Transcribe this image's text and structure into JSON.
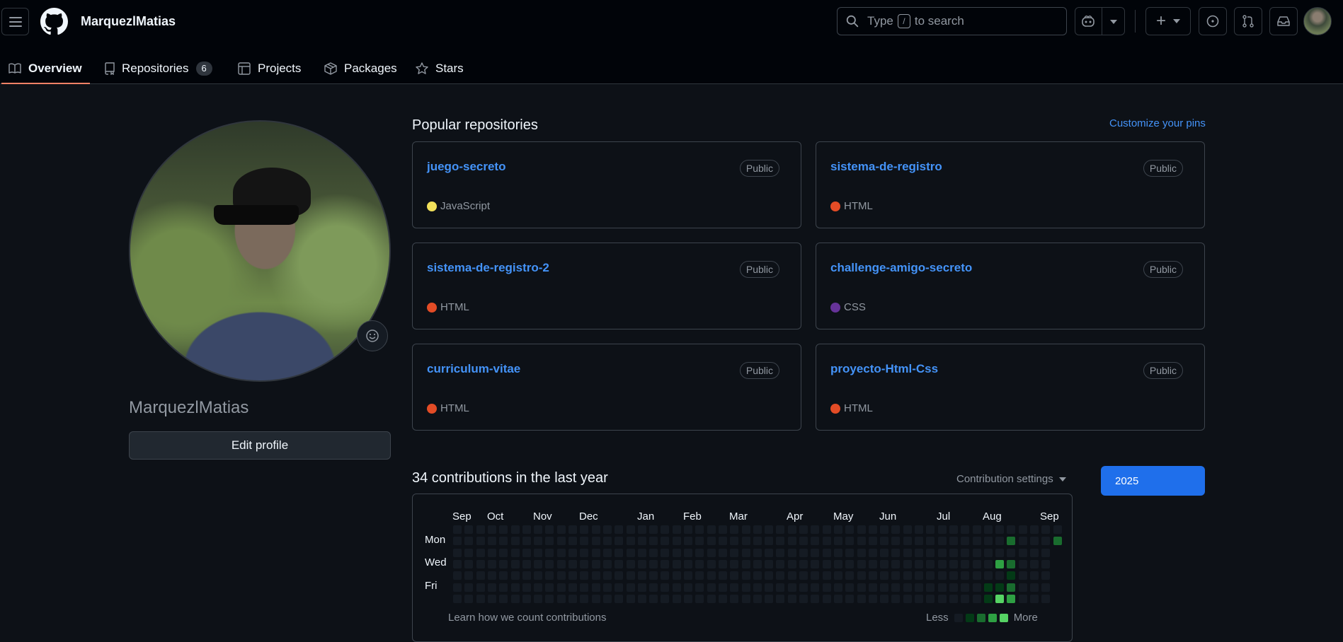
{
  "header": {
    "username": "MarquezlMatias",
    "search": {
      "prefix": "Type",
      "key": "/",
      "suffix": "to search"
    },
    "plus_label": "+"
  },
  "nav": {
    "tabs": [
      {
        "label": "Overview",
        "icon": "book-icon",
        "active": true
      },
      {
        "label": "Repositories",
        "icon": "repo-icon",
        "count": "6"
      },
      {
        "label": "Projects",
        "icon": "table-icon"
      },
      {
        "label": "Packages",
        "icon": "package-icon"
      },
      {
        "label": "Stars",
        "icon": "star-icon"
      }
    ]
  },
  "profile": {
    "name": "MarquezlMatias",
    "edit_label": "Edit profile"
  },
  "popular": {
    "title": "Popular repositories",
    "customize": "Customize your pins",
    "repos": [
      {
        "name": "juego-secreto",
        "visibility": "Public",
        "language": "JavaScript",
        "color": "#f1e05a"
      },
      {
        "name": "sistema-de-registro",
        "visibility": "Public",
        "language": "HTML",
        "color": "#e34c26"
      },
      {
        "name": "sistema-de-registro-2",
        "visibility": "Public",
        "language": "HTML",
        "color": "#e34c26"
      },
      {
        "name": "challenge-amigo-secreto",
        "visibility": "Public",
        "language": "CSS",
        "color": "#663399"
      },
      {
        "name": "curriculum-vitae",
        "visibility": "Public",
        "language": "HTML",
        "color": "#e34c26"
      },
      {
        "name": "proyecto-Html-Css",
        "visibility": "Public",
        "language": "HTML",
        "color": "#e34c26"
      }
    ]
  },
  "contributions": {
    "title": "34 contributions in the last year",
    "settings": "Contribution settings",
    "year": "2025",
    "months": [
      "Sep",
      "Oct",
      "Nov",
      "Dec",
      "Jan",
      "Feb",
      "Mar",
      "Apr",
      "May",
      "Jun",
      "Jul",
      "Aug",
      "Sep"
    ],
    "days": [
      "Mon",
      "Wed",
      "Fri"
    ],
    "learn": "Learn how we count contributions",
    "legend_less": "Less",
    "legend_more": "More",
    "level_colors": [
      "#151b23",
      "#033a16",
      "#196c2e",
      "#2ea043",
      "#56d364"
    ],
    "active_cells": [
      {
        "week": 48,
        "day": 1,
        "level": 2
      },
      {
        "week": 52,
        "day": 1,
        "level": 2
      },
      {
        "week": 47,
        "day": 3,
        "level": 3
      },
      {
        "week": 48,
        "day": 3,
        "level": 2
      },
      {
        "week": 48,
        "day": 4,
        "level": 1
      },
      {
        "week": 47,
        "day": 5,
        "level": 1
      },
      {
        "week": 48,
        "day": 5,
        "level": 2
      },
      {
        "week": 46,
        "day": 5,
        "level": 1
      },
      {
        "week": 46,
        "day": 6,
        "level": 1
      },
      {
        "week": 47,
        "day": 6,
        "level": 4
      },
      {
        "week": 48,
        "day": 6,
        "level": 3
      }
    ]
  }
}
